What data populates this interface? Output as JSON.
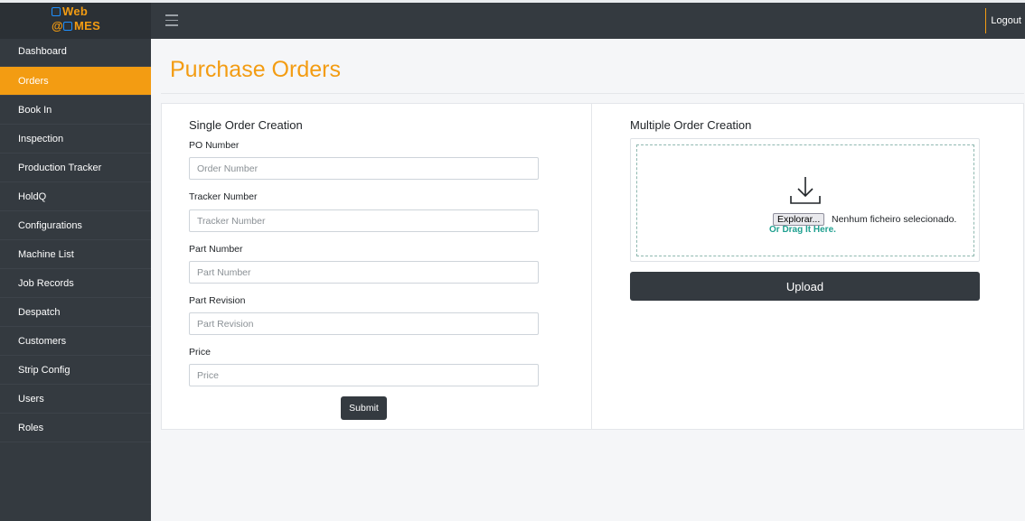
{
  "brand": {
    "line1": "Web",
    "line2": "@ MES",
    "at": "@",
    "mes": "MES",
    "color": "#f39c12"
  },
  "topbar": {
    "logout_label": "Logout",
    "menu_icon": "hamburger-icon"
  },
  "sidebar": {
    "items": [
      {
        "label": "Dashboard"
      },
      {
        "label": "Orders",
        "active": true
      },
      {
        "label": "Book In"
      },
      {
        "label": "Inspection"
      },
      {
        "label": "Production Tracker"
      },
      {
        "label": "HoldQ"
      },
      {
        "label": "Configurations"
      },
      {
        "label": "Machine List"
      },
      {
        "label": "Job Records"
      },
      {
        "label": "Despatch"
      },
      {
        "label": "Customers"
      },
      {
        "label": "Strip Config"
      },
      {
        "label": "Users"
      },
      {
        "label": "Roles"
      }
    ]
  },
  "page": {
    "title": "Purchase Orders"
  },
  "single": {
    "title": "Single Order Creation",
    "fields": [
      {
        "label": "PO Number",
        "placeholder": "Order Number",
        "value": ""
      },
      {
        "label": "Tracker Number",
        "placeholder": "Tracker Number",
        "value": ""
      },
      {
        "label": "Part Number",
        "placeholder": "Part Number",
        "value": ""
      },
      {
        "label": "Part Revision",
        "placeholder": "Part Revision",
        "value": ""
      },
      {
        "label": "Price",
        "placeholder": "Price",
        "value": ""
      }
    ],
    "submit_label": "Submit"
  },
  "multiple": {
    "title": "Multiple Order Creation",
    "dropzone": {
      "icon": "download-icon",
      "browse_label": "Explorar...",
      "file_status": "Nenhum ficheiro selecionado.",
      "drag_hint": "Or Drag It Here."
    },
    "upload_label": "Upload"
  },
  "colors": {
    "accent": "#f39c12",
    "dark": "#343a40",
    "hint": "#20a090"
  }
}
